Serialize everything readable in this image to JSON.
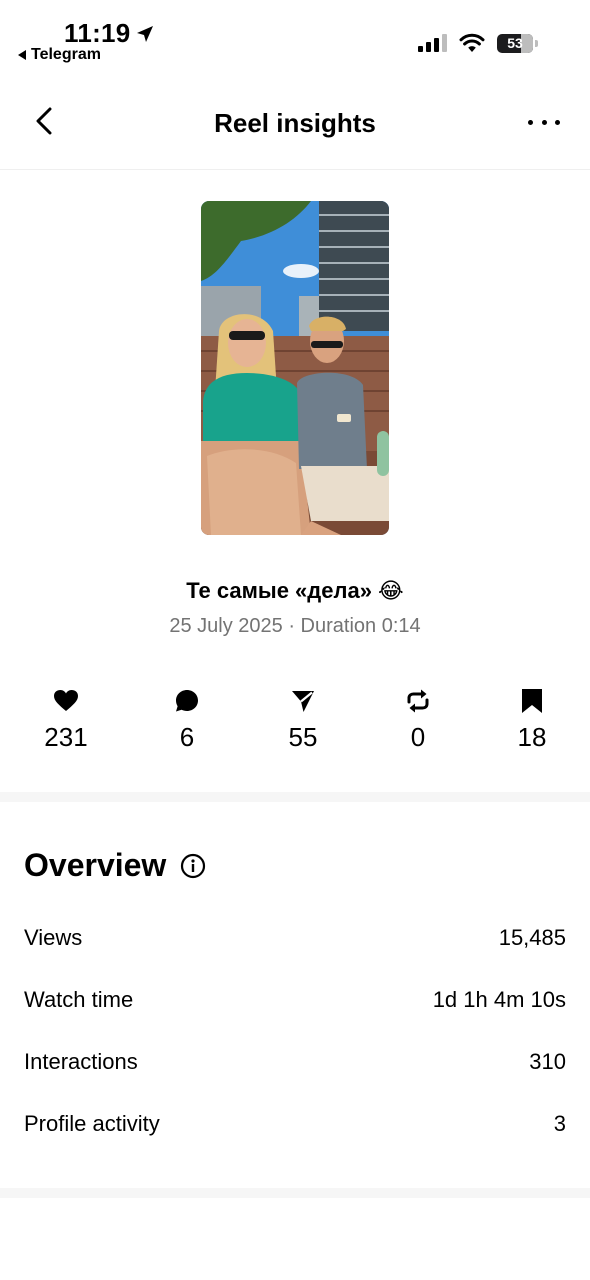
{
  "status_bar": {
    "time": "11:19",
    "back_app": "Telegram",
    "battery": "53",
    "icons": [
      "location-arrow-icon",
      "signal-icon",
      "wifi-icon",
      "battery-icon"
    ]
  },
  "header": {
    "title": "Reel insights",
    "icons": [
      "back-chevron-icon",
      "more-dots-icon"
    ]
  },
  "reel": {
    "caption": "Те самые «дела» 😂",
    "meta": "25 July 2025 · Duration 0:14"
  },
  "stats": [
    {
      "icon": "heart-icon",
      "value": "231"
    },
    {
      "icon": "comment-icon",
      "value": "6"
    },
    {
      "icon": "share-icon",
      "value": "55"
    },
    {
      "icon": "repost-icon",
      "value": "0"
    },
    {
      "icon": "bookmark-icon",
      "value": "18"
    }
  ],
  "overview": {
    "title": "Overview",
    "rows": [
      {
        "label": "Views",
        "value": "15,485"
      },
      {
        "label": "Watch time",
        "value": "1d 1h 4m 10s"
      },
      {
        "label": "Interactions",
        "value": "310"
      },
      {
        "label": "Profile activity",
        "value": "3"
      }
    ]
  }
}
